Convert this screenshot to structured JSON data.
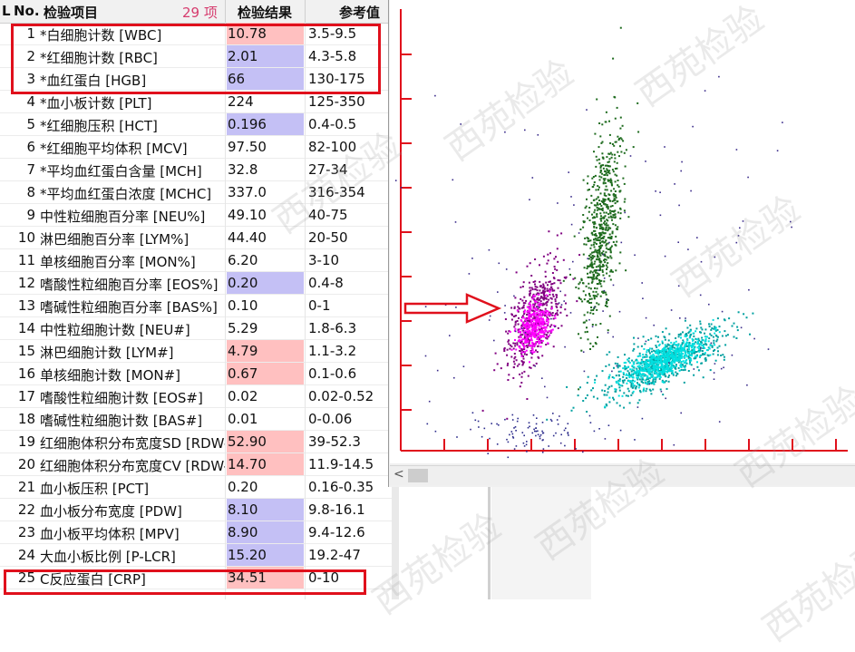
{
  "header": {
    "col_l": "L",
    "col_no": "No.",
    "col_item": "检验项目",
    "count": "29 项",
    "col_result": "检验结果",
    "col_ref": "参考值"
  },
  "rows": [
    {
      "no": "1",
      "name": "*白细胞计数 [WBC]",
      "result": "10.78",
      "ref": "3.5-9.5",
      "flag": "high"
    },
    {
      "no": "2",
      "name": "*红细胞计数 [RBC]",
      "result": "2.01",
      "ref": "4.3-5.8",
      "flag": "low"
    },
    {
      "no": "3",
      "name": "*血红蛋白 [HGB]",
      "result": "66",
      "ref": "130-175",
      "flag": "low"
    },
    {
      "no": "4",
      "name": "*血小板计数 [PLT]",
      "result": "224",
      "ref": "125-350",
      "flag": "none"
    },
    {
      "no": "5",
      "name": "*红细胞压积 [HCT]",
      "result": "0.196",
      "ref": "0.4-0.5",
      "flag": "low"
    },
    {
      "no": "6",
      "name": "*红细胞平均体积 [MCV]",
      "result": "97.50",
      "ref": "82-100",
      "flag": "none"
    },
    {
      "no": "7",
      "name": "*平均血红蛋白含量 [MCH]",
      "result": "32.8",
      "ref": "27-34",
      "flag": "none"
    },
    {
      "no": "8",
      "name": "*平均血红蛋白浓度 [MCHC]",
      "result": "337.0",
      "ref": "316-354",
      "flag": "none"
    },
    {
      "no": "9",
      "name": "中性粒细胞百分率 [NEU%]",
      "result": "49.10",
      "ref": "40-75",
      "flag": "none"
    },
    {
      "no": "10",
      "name": "淋巴细胞百分率 [LYM%]",
      "result": "44.40",
      "ref": "20-50",
      "flag": "none"
    },
    {
      "no": "11",
      "name": "单核细胞百分率 [MON%]",
      "result": "6.20",
      "ref": "3-10",
      "flag": "none"
    },
    {
      "no": "12",
      "name": "嗜酸性粒细胞百分率 [EOS%]",
      "result": "0.20",
      "ref": "0.4-8",
      "flag": "low"
    },
    {
      "no": "13",
      "name": "嗜碱性粒细胞百分率 [BAS%]",
      "result": "0.10",
      "ref": "0-1",
      "flag": "none"
    },
    {
      "no": "14",
      "name": "中性粒细胞计数 [NEU#]",
      "result": "5.29",
      "ref": "1.8-6.3",
      "flag": "none"
    },
    {
      "no": "15",
      "name": "淋巴细胞计数 [LYM#]",
      "result": "4.79",
      "ref": "1.1-3.2",
      "flag": "high"
    },
    {
      "no": "16",
      "name": "单核细胞计数 [MON#]",
      "result": "0.67",
      "ref": "0.1-0.6",
      "flag": "high"
    },
    {
      "no": "17",
      "name": "嗜酸性粒细胞计数 [EOS#]",
      "result": "0.02",
      "ref": "0.02-0.52",
      "flag": "none"
    },
    {
      "no": "18",
      "name": "嗜碱性粒细胞计数 [BAS#]",
      "result": "0.01",
      "ref": "0-0.06",
      "flag": "none"
    },
    {
      "no": "19",
      "name": "红细胞体积分布宽度SD [RDW-SD]",
      "result": "52.90",
      "ref": "39-52.3",
      "flag": "high"
    },
    {
      "no": "20",
      "name": "红细胞体积分布宽度CV [RDW-CV]",
      "result": "14.70",
      "ref": "11.9-14.5",
      "flag": "high"
    },
    {
      "no": "21",
      "name": "血小板压积 [PCT]",
      "result": "0.20",
      "ref": "0.16-0.35",
      "flag": "none"
    },
    {
      "no": "22",
      "name": "血小板分布宽度 [PDW]",
      "result": "8.10",
      "ref": "9.8-16.1",
      "flag": "low"
    },
    {
      "no": "23",
      "name": "血小板平均体积 [MPV]",
      "result": "8.90",
      "ref": "9.4-12.6",
      "flag": "low"
    },
    {
      "no": "24",
      "name": "大血小板比例 [P-LCR]",
      "result": "15.20",
      "ref": "19.2-47",
      "flag": "low"
    },
    {
      "no": "25",
      "name": "C反应蛋白 [CRP]",
      "result": "34.51",
      "ref": "0-10",
      "flag": "high"
    }
  ],
  "watermark": "西苑检验",
  "colors": {
    "high": "#ffc0c0",
    "low": "#c4c0f5",
    "highlight_box": "#e0101c",
    "axis": "#e0101c",
    "cluster_neu": "#1e6b1e",
    "cluster_lym": "#00e0e0",
    "cluster_mon": "#800080",
    "cluster_eos": "#ff00ff"
  },
  "plot": {
    "scroll_left_icon": "chevron-left-icon"
  }
}
